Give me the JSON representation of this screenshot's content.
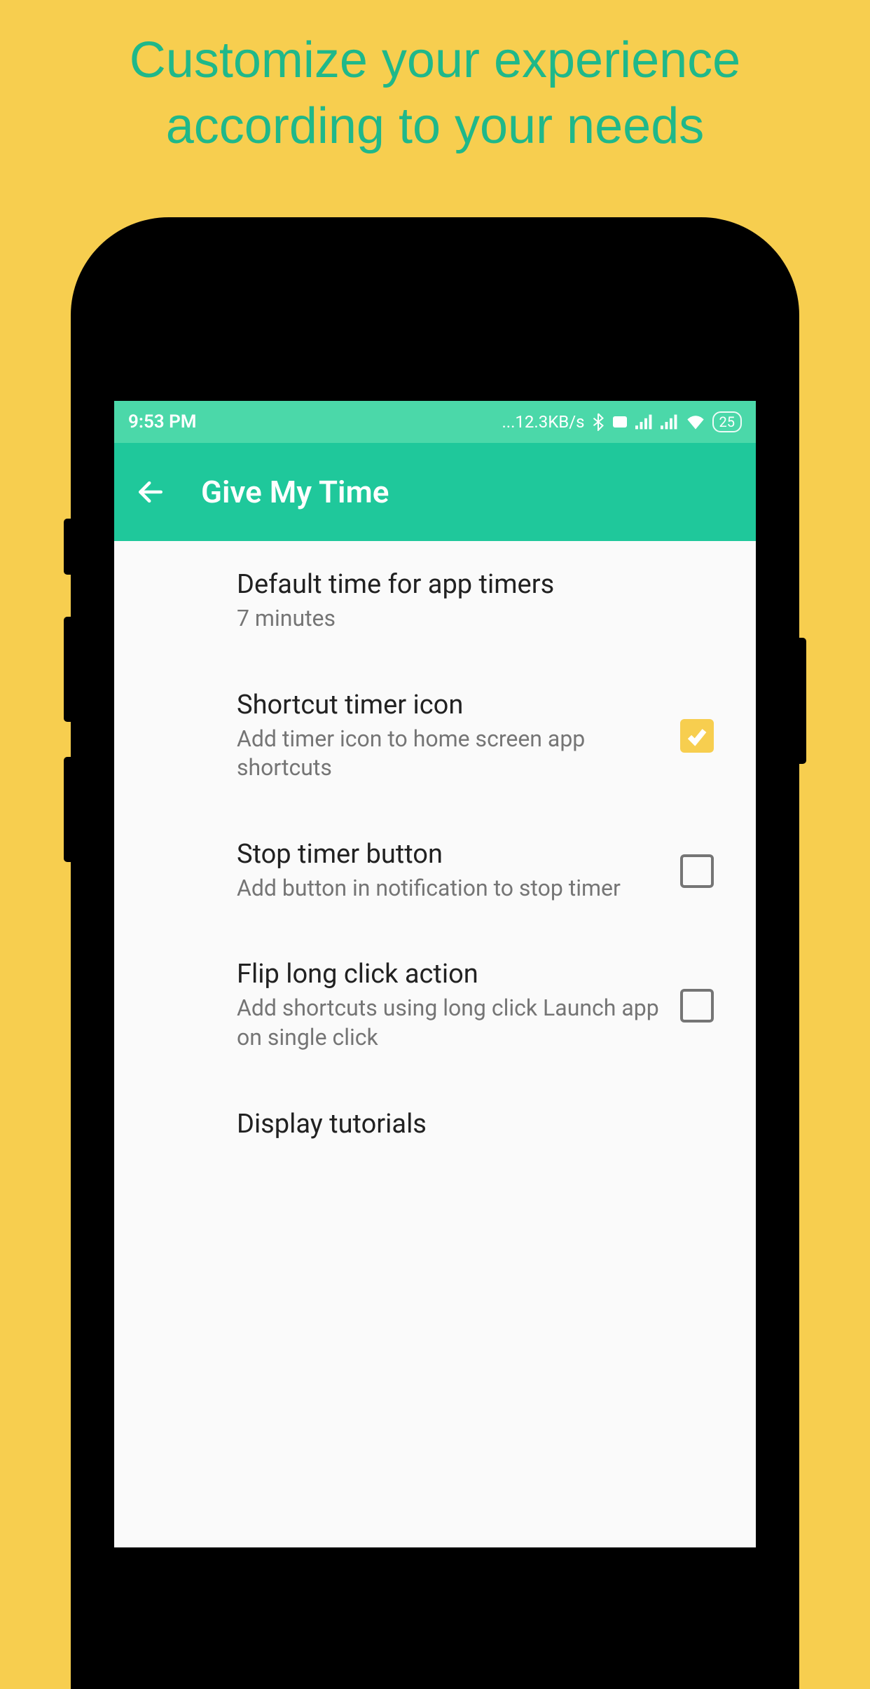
{
  "promo": {
    "line1": "Customize your experience",
    "line2": "according to your needs"
  },
  "status_bar": {
    "time": "9:53 PM",
    "data_rate": "...12.3KB/s",
    "battery": "25"
  },
  "app_bar": {
    "title": "Give My Time"
  },
  "settings": {
    "default_timer": {
      "title": "Default time for app timers",
      "subtitle": "7 minutes"
    },
    "shortcut_icon": {
      "title": "Shortcut timer icon",
      "subtitle": "Add timer icon to home screen app shortcuts",
      "checked": true
    },
    "stop_button": {
      "title": "Stop timer button",
      "subtitle": "Add button in notification to stop timer",
      "checked": false
    },
    "flip_click": {
      "title": "Flip long click action",
      "subtitle": "Add shortcuts using long click Launch app on single click",
      "checked": false
    },
    "display_tutorials": {
      "title": "Display tutorials"
    }
  }
}
